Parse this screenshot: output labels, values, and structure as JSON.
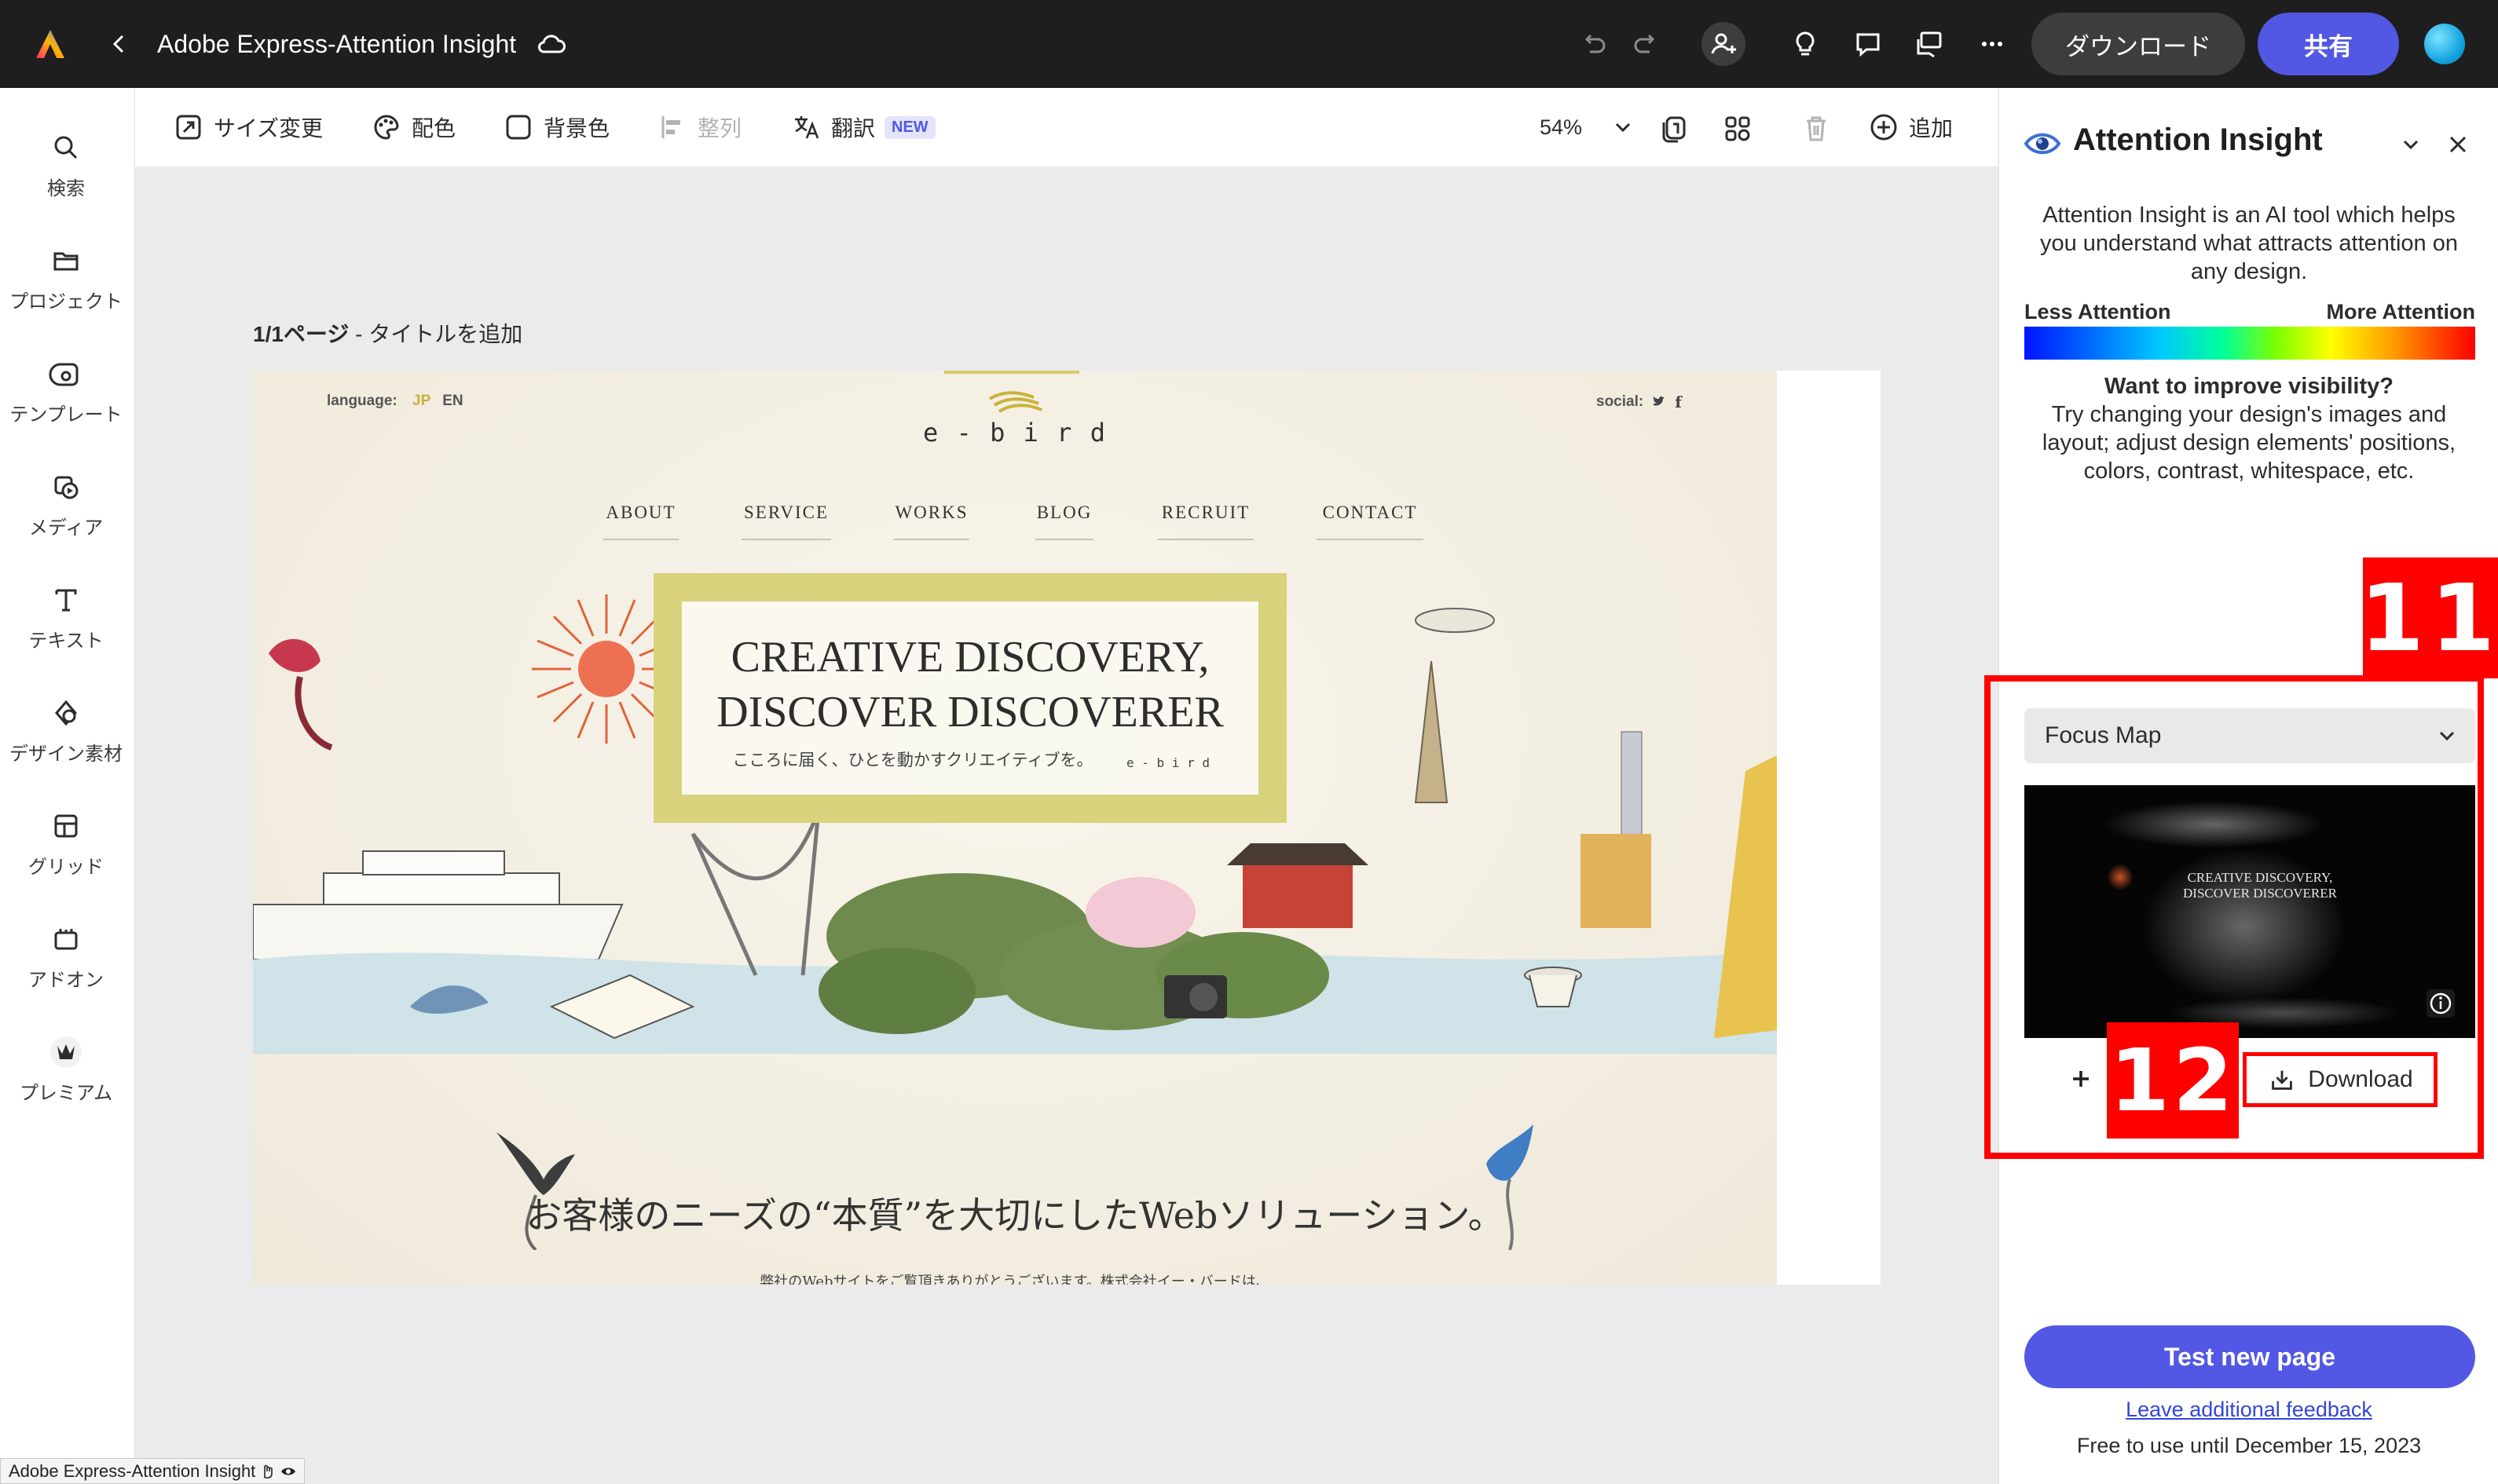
{
  "app": {
    "title": "Adobe Express-Attention Insight"
  },
  "topbar": {
    "download_label": "ダウンロード",
    "share_label": "共有"
  },
  "leftrail": {
    "items": [
      {
        "label": "検索",
        "icon": "search-icon"
      },
      {
        "label": "プロジェクト",
        "icon": "folder-icon"
      },
      {
        "label": "テンプレート",
        "icon": "template-icon"
      },
      {
        "label": "メディア",
        "icon": "media-icon"
      },
      {
        "label": "テキスト",
        "icon": "text-icon"
      },
      {
        "label": "デザイン素材",
        "icon": "shapes-icon"
      },
      {
        "label": "グリッド",
        "icon": "grid-icon"
      },
      {
        "label": "アドオン",
        "icon": "addons-icon"
      },
      {
        "label": "プレミアム",
        "icon": "crown-icon"
      }
    ]
  },
  "toolbar": {
    "resize": "サイズ変更",
    "color": "配色",
    "background": "背景色",
    "align": "整列",
    "translate": "翻訳",
    "new_badge": "NEW",
    "zoom": "54%",
    "add": "追加"
  },
  "canvas": {
    "page_number": "1/1ページ",
    "page_title_placeholder": " - タイトルを追加"
  },
  "design": {
    "language_label": "language:",
    "lang_jp": "JP",
    "lang_en": "EN",
    "social_label": "social:",
    "brand": "e - b i r d",
    "nav": [
      "ABOUT",
      "SERVICE",
      "WORKS",
      "BLOG",
      "RECRUIT",
      "CONTACT"
    ],
    "headline_1": "CREATIVE DISCOVERY,",
    "headline_2": "DISCOVER DISCOVERER",
    "subline": "こころに届く、ひとを動かすクリエイティブを。",
    "subline_brand": "e - b i r d",
    "tagline": "お客様のニーズの“本質”を大切にしたWebソリューション。",
    "body_cut": "弊社のWebサイトをご覧頂きありがとうございます。株式会社イー・バードは、"
  },
  "panel": {
    "title": "Attention Insight",
    "description": "Attention Insight is an AI tool which helps you understand what attracts attention on any design.",
    "legend_less": "Less Attention",
    "legend_more": "More Attention",
    "improve_title": "Want to improve visibility?",
    "improve_body": "Try changing your design's images and layout; adjust design elements' positions, colors, contrast, whitespace, etc.",
    "focus_select": "Focus Map",
    "thumb_text_1": "CREATIVE DISCOVERY,",
    "thumb_text_2": "DISCOVER DISCOVERER",
    "download": "Download",
    "test_button": "Test new page",
    "feedback_link": "Leave additional feedback",
    "free_until": "Free to use until December 15, 2023"
  },
  "annotations": {
    "box_11": "11",
    "box_12": "12"
  },
  "status_bar": {
    "text": "Adobe Express-Attention Insight"
  },
  "colors": {
    "accent": "#5258e4",
    "annotation": "#ff0000",
    "topbar": "#1e1e1e"
  }
}
